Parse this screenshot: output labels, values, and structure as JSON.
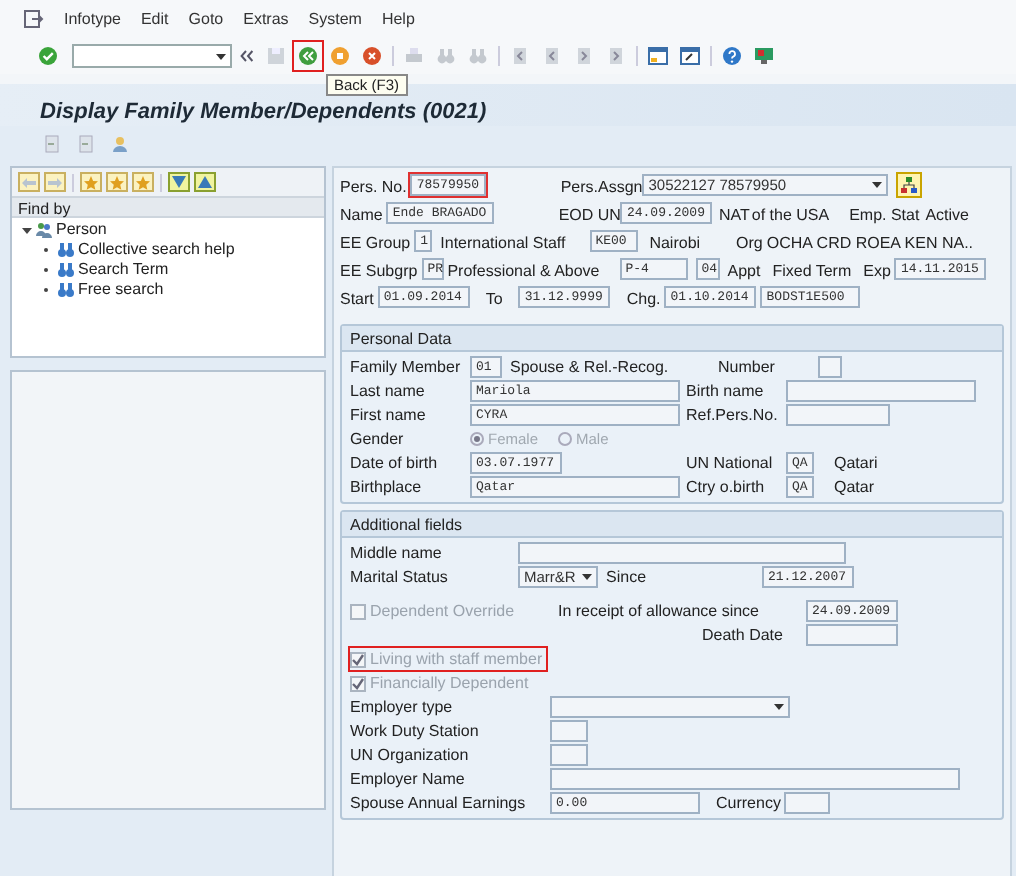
{
  "menu": [
    {
      "label": "Infotype"
    },
    {
      "label": "Edit"
    },
    {
      "label": "Goto"
    },
    {
      "label": "Extras"
    },
    {
      "label": "System"
    },
    {
      "label": "Help"
    }
  ],
  "toolbar": {
    "back_highlighted": true,
    "tooltip": "Back (F3)"
  },
  "title": "Display Family Member/Dependents (0021)",
  "nav": {
    "header": "Find by",
    "tree": [
      {
        "label": "Person",
        "expanded": true,
        "children": [
          {
            "label": "Collective search help"
          },
          {
            "label": "Search Term"
          },
          {
            "label": "Free search"
          }
        ]
      }
    ]
  },
  "header": [
    [
      {
        "kind": "label",
        "text": "Pers. No."
      },
      {
        "kind": "field",
        "text": "78579950",
        "highlighted": true
      },
      {
        "kind": "label",
        "text": "Pers.Assgn"
      },
      {
        "kind": "select",
        "text": "30522127 78579950"
      },
      {
        "kind": "button"
      }
    ],
    [
      {
        "kind": "label",
        "text": "Name"
      },
      {
        "kind": "field",
        "text": "Ende BRAGADO",
        "highlighted": false
      },
      {
        "kind": "label",
        "text": "EOD UN"
      },
      {
        "kind": "field",
        "text": "24.09.2009",
        "highlighted": false
      },
      {
        "kind": "text",
        "text": "NAT"
      },
      {
        "kind": "text",
        "text": "of the USA"
      },
      {
        "kind": "label",
        "text": "Emp. Stat"
      },
      {
        "kind": "text",
        "text": "Active"
      }
    ],
    [
      {
        "kind": "label",
        "text": "EE Group"
      },
      {
        "kind": "field",
        "text": "1",
        "highlighted": false
      },
      {
        "kind": "text",
        "text": "International Staff"
      },
      {
        "kind": "field",
        "text": "KE00",
        "highlighted": false
      },
      {
        "kind": "text",
        "text": "Nairobi"
      },
      {
        "kind": "label",
        "text": "Org"
      },
      {
        "kind": "text",
        "text": "OCHA CRD ROEA KEN NA.."
      }
    ],
    [
      {
        "kind": "label",
        "text": "EE Subgrp"
      },
      {
        "kind": "field",
        "text": "PR",
        "highlighted": false
      },
      {
        "kind": "text",
        "text": "Professional & Above"
      },
      {
        "kind": "field",
        "text": "P-4",
        "highlighted": false
      },
      {
        "kind": "field",
        "text": "04",
        "highlighted": false
      },
      {
        "kind": "text",
        "text": "Appt"
      },
      {
        "kind": "text",
        "text": "Fixed Term"
      },
      {
        "kind": "label",
        "text": "Exp"
      },
      {
        "kind": "field",
        "text": "14.11.2015",
        "highlighted": false
      }
    ],
    [
      {
        "kind": "label",
        "text": "Start"
      },
      {
        "kind": "field",
        "text": "01.09.2014",
        "highlighted": false
      },
      {
        "kind": "label",
        "text": "To"
      },
      {
        "kind": "field",
        "text": "31.12.9999",
        "highlighted": false
      },
      {
        "kind": "label",
        "text": "Chg."
      },
      {
        "kind": "field",
        "text": "01.10.2014",
        "highlighted": false
      },
      {
        "kind": "field",
        "text": "BODST1E500",
        "highlighted": false
      }
    ]
  ],
  "personal_data": {
    "title": "Personal Data",
    "family_member": {
      "label": "Family Member",
      "value": "01",
      "text": "Spouse & Rel.-Recog."
    },
    "number": {
      "label": "Number"
    },
    "last_name": {
      "label": "Last name",
      "value": "Mariola"
    },
    "birth_name": {
      "label": "Birth name"
    },
    "first_name": {
      "label": "First name",
      "value": "CYRA"
    },
    "ref_pers_no": {
      "label": "Ref.Pers.No."
    },
    "gender": {
      "label": "Gender",
      "disabled": true,
      "options": [
        {
          "label": "Female",
          "selected": true
        },
        {
          "label": "Male",
          "selected": false
        }
      ]
    },
    "date_of_birth": {
      "label": "Date of birth",
      "value": "03.07.1977"
    },
    "un_national": {
      "label": "UN National",
      "value": "QA",
      "text": "Qatari"
    },
    "birthplace": {
      "label": "Birthplace",
      "value": "Qatar"
    },
    "ctry_of_birth": {
      "label": "Ctry o.birth",
      "value": "QA",
      "text": "Qatar"
    }
  },
  "additional_fields": {
    "title": "Additional fields",
    "middle_name": {
      "label": "Middle name"
    },
    "marital_status": {
      "label": "Marital Status",
      "value": "Marr&R"
    },
    "since": {
      "label": "Since",
      "value": "21.12.2007"
    },
    "dependent_override": {
      "label": "Dependent Override",
      "checked": false,
      "disabled": true,
      "highlighted": false
    },
    "allowance_since": {
      "label": "In receipt of allowance since",
      "value": "24.09.2009"
    },
    "death_date": {
      "label": "Death Date"
    },
    "living_with_staff": {
      "label": "Living with staff member",
      "checked": true,
      "disabled": true,
      "highlighted": true
    },
    "financially_dependent": {
      "label": "Financially Dependent",
      "checked": true,
      "disabled": true,
      "highlighted": false
    },
    "employer_type": {
      "label": "Employer type"
    },
    "work_duty_station": {
      "label": "Work Duty Station"
    },
    "un_organization": {
      "label": "UN Organization"
    },
    "employer_name": {
      "label": "Employer Name"
    },
    "spouse_earnings": {
      "label": "Spouse Annual Earnings",
      "value": "0.00"
    },
    "currency": {
      "label": "Currency"
    }
  }
}
